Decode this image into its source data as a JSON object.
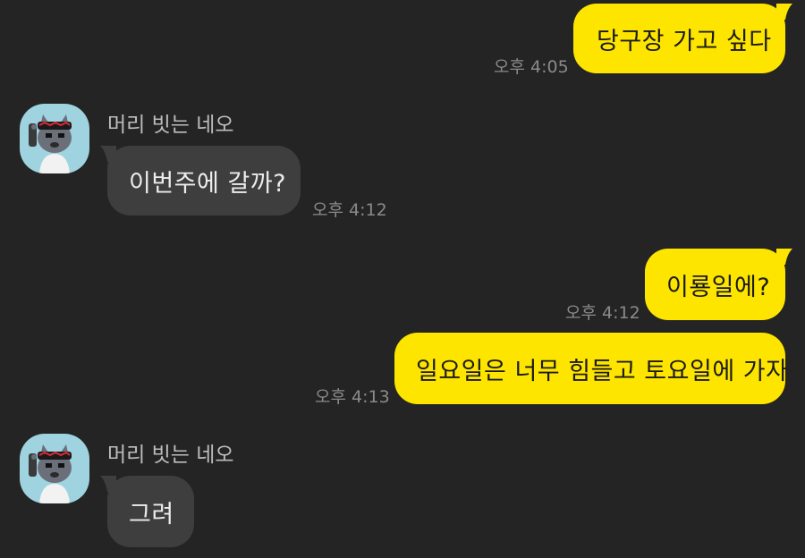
{
  "messages": [
    {
      "id": "m1",
      "direction": "out",
      "text": "당구장 가고 싶다",
      "time": "오후 4:05"
    },
    {
      "id": "m2",
      "direction": "in",
      "sender": "머리 빗는 네오",
      "text": "이번주에 갈까?",
      "time": "오후 4:12"
    },
    {
      "id": "m3",
      "direction": "out",
      "text": "이룡일에?",
      "time": "오후 4:12"
    },
    {
      "id": "m4",
      "direction": "out",
      "text": "일요일은 너무 힘들고 토요일에 가자",
      "time": "오후 4:13"
    },
    {
      "id": "m5",
      "direction": "in",
      "sender": "머리 빗는 네오",
      "text": "그려"
    }
  ],
  "avatar_icon": "neo-combing-hair-avatar",
  "colors": {
    "background": "#242424",
    "outgoing_bubble": "#fee500",
    "incoming_bubble": "#3e3e3e",
    "avatar_background": "#9ed3df"
  }
}
